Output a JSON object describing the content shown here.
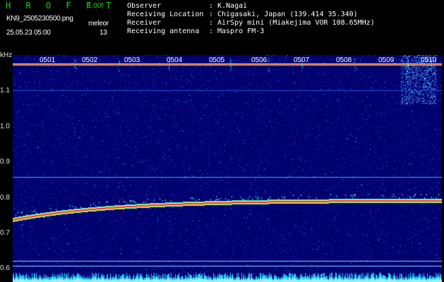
{
  "header": {
    "app_name": "H R O F F T",
    "version": "1.00f",
    "filename": "KN9_2505230500.png",
    "datetime": "25.05.23 05:00",
    "mode_label": "meleor",
    "count": "13",
    "fields": [
      {
        "label": "Observer",
        "value": "K.Nagai"
      },
      {
        "label": "Receiving Location",
        "value": "Chigasaki, Japan (139.414 35.340)"
      },
      {
        "label": "Receiver",
        "value": "AirSpy mini (Miakejima VOR 108.65MHz)"
      },
      {
        "label": "Receiving antenna",
        "value": "Maspro FM-3"
      }
    ]
  },
  "axis": {
    "unit": "kHz",
    "y_ticks": [
      "1.1",
      "1.0",
      "0.9",
      "0.8",
      "0.7",
      "0.6"
    ],
    "time_labels": [
      "0501",
      "0502",
      "0503",
      "0504",
      "0505",
      "0506",
      "0507",
      "0508",
      "0509",
      "0510"
    ]
  },
  "colors": {
    "background": "#00006e",
    "trace_hot": "#ff3030",
    "trace_warm": "#ffe060",
    "trace_cool": "#40ffb0",
    "noise": "#1f3fd0",
    "label_green": "#1fd21f"
  }
}
